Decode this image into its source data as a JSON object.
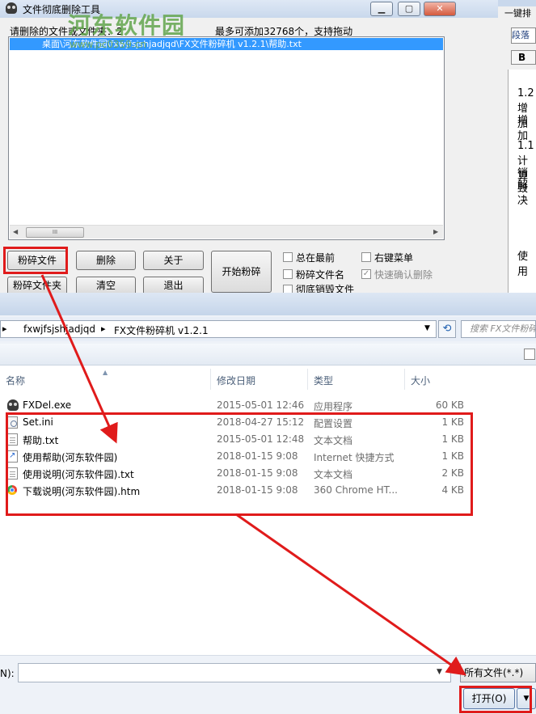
{
  "shredder": {
    "title": "文件彻底删除工具",
    "watermark": "河东软件园",
    "watermark_url": "www.pc0359.cn",
    "label_left": "请删除的文件或文件夹：2",
    "label_right": "最多可添加32768个，支持拖动",
    "file_entry": "桌面\\河东软件园\\fxwjfsjshjadjqd\\FX文件粉碎机 v1.2.1\\帮助.txt",
    "scroll_thumb": "III",
    "buttons": {
      "shred_file": "粉碎文件",
      "delete": "删除",
      "about": "关于",
      "start_shred": "开始粉碎",
      "shred_folder": "粉碎文件夹",
      "clear": "清空",
      "exit": "退出"
    },
    "checkboxes": {
      "always_on_top": "总在最前",
      "shred_filename": "粉碎文件名",
      "thorough_destroy": "彻底销毁文件",
      "context_menu": "右键菜单",
      "quick_confirm": "快速确认删除"
    }
  },
  "right_window": {
    "tab1": "一键排",
    "tab2": "段落",
    "bold": "B",
    "lines": [
      "1.2",
      "增加",
      "增加",
      "1.1",
      "计算",
      "销毁",
      "解决",
      "使用"
    ]
  },
  "dialog": {
    "breadcrumb": [
      "fxwjfsjshjadjqd",
      "FX文件粉碎机 v1.2.1"
    ],
    "search_placeholder": "搜索 FX文件粉碎机",
    "columns": {
      "name": "名称",
      "date": "修改日期",
      "type": "类型",
      "size": "大小"
    },
    "files": [
      {
        "name": "FXDel.exe",
        "date": "2015-05-01 12:46",
        "type": "应用程序",
        "size": "60 KB",
        "icon": "skull-icon"
      },
      {
        "name": "Set.ini",
        "date": "2018-04-27 15:12",
        "type": "配置设置",
        "size": "1 KB",
        "icon": "ini-icon"
      },
      {
        "name": "帮助.txt",
        "date": "2015-05-01 12:48",
        "type": "文本文档",
        "size": "1 KB",
        "icon": "text-file-icon"
      },
      {
        "name": "使用帮助(河东软件园)",
        "date": "2018-01-15 9:08",
        "type": "Internet 快捷方式",
        "size": "1 KB",
        "icon": "shortcut-icon"
      },
      {
        "name": "使用说明(河东软件园).txt",
        "date": "2018-01-15 9:08",
        "type": "文本文档",
        "size": "2 KB",
        "icon": "text-file-icon"
      },
      {
        "name": "下载说明(河东软件园).htm",
        "date": "2018-01-15 9:08",
        "type": "360 Chrome HT...",
        "size": "4 KB",
        "icon": "chrome-icon"
      }
    ],
    "filename_label": "N):",
    "filter": "所有文件(*.*)",
    "open_button": "打开(O)"
  },
  "colors": {
    "annotation_red": "#e01b1b",
    "selection_blue": "#3399ff"
  }
}
